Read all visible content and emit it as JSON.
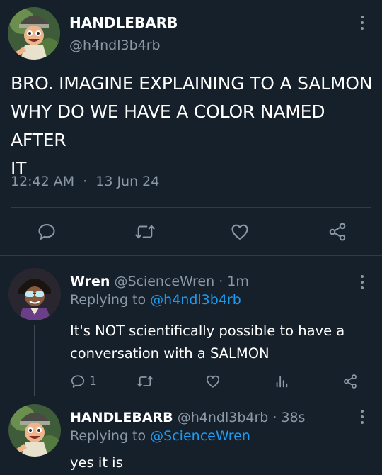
{
  "main_tweet": {
    "display_name": "HANDLEBARB",
    "handle": "@h4ndl3b4rb",
    "text_lines": [
      "BRO. IMAGINE EXPLAINING TO A SALMON",
      "WHY DO WE HAVE A COLOR NAMED AFTER",
      "IT"
    ],
    "time": "12:42 AM",
    "separator": "·",
    "date": "13 Jun 24"
  },
  "reply1": {
    "display_name": "Wren",
    "handle": "@ScienceWren",
    "time": "· 1m",
    "replying_label": "Replying to",
    "replying_to": "@h4ndl3b4rb",
    "text_lines": [
      "It's NOT scientifically possible to have a",
      "conversation with a SALMON"
    ],
    "reply_count": "1"
  },
  "reply2": {
    "display_name": "HANDLEBARB",
    "handle": "@h4ndl3b4rb",
    "time": "· 38s",
    "replying_label": "Replying to",
    "replying_to": "@ScienceWren",
    "text": "yes it is"
  },
  "colors": {
    "background": "#15202b",
    "muted": "#8b98a5",
    "link": "#1d9bf0",
    "divider": "#2f3b47"
  },
  "icons": [
    "more-icon",
    "reply-icon",
    "retweet-icon",
    "like-icon",
    "share-icon",
    "analytics-icon"
  ]
}
